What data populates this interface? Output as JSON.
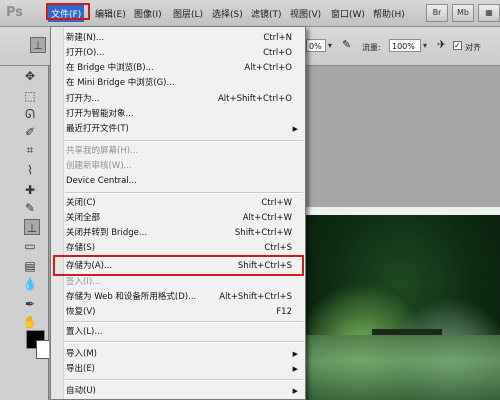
{
  "app": {
    "logo": "Ps"
  },
  "menubar": {
    "items": [
      "文件(F)",
      "编辑(E)",
      "图像(I)",
      "图层(L)",
      "选择(S)",
      "滤镜(T)",
      "视图(V)",
      "窗口(W)",
      "帮助(H)"
    ],
    "buttons": [
      "Br",
      "Mb"
    ]
  },
  "options": {
    "zoom_value": "0%",
    "flow_label": "流量:",
    "flow_value": "100%",
    "align_label": "对齐"
  },
  "file_menu": {
    "items": [
      {
        "label": "新建(N)...",
        "shortcut": "Ctrl+N"
      },
      {
        "label": "打开(O)...",
        "shortcut": "Ctrl+O"
      },
      {
        "label": "在 Bridge 中浏览(B)...",
        "shortcut": "Alt+Ctrl+O"
      },
      {
        "label": "在 Mini Bridge 中浏览(G)...",
        "shortcut": ""
      },
      {
        "label": "打开为...",
        "shortcut": "Alt+Shift+Ctrl+O"
      },
      {
        "label": "打开为智能对象...",
        "shortcut": ""
      },
      {
        "label": "最近打开文件(T)",
        "shortcut": ""
      },
      {
        "label": "共享我的屏幕(H)...",
        "shortcut": ""
      },
      {
        "label": "创建新审核(W)...",
        "shortcut": ""
      },
      {
        "label": "Device Central...",
        "shortcut": ""
      },
      {
        "label": "关闭(C)",
        "shortcut": "Ctrl+W"
      },
      {
        "label": "关闭全部",
        "shortcut": "Alt+Ctrl+W"
      },
      {
        "label": "关闭并转到 Bridge...",
        "shortcut": "Shift+Ctrl+W"
      },
      {
        "label": "存储(S)",
        "shortcut": "Ctrl+S"
      },
      {
        "label": "存储为(A)...",
        "shortcut": "Shift+Ctrl+S"
      },
      {
        "label": "签入(I)...",
        "shortcut": ""
      },
      {
        "label": "存储为 Web 和设备所用格式(D)...",
        "shortcut": "Alt+Shift+Ctrl+S"
      },
      {
        "label": "恢复(V)",
        "shortcut": "F12"
      },
      {
        "label": "置入(L)...",
        "shortcut": ""
      },
      {
        "label": "导入(M)",
        "shortcut": ""
      },
      {
        "label": "导出(E)",
        "shortcut": ""
      },
      {
        "label": "自动(U)",
        "shortcut": ""
      }
    ]
  },
  "tools": [
    "move-tool",
    "marquee-tool",
    "lasso-tool",
    "quick-select-tool",
    "crop-tool",
    "eyedropper-tool",
    "healing-tool",
    "brush-tool",
    "clone-stamp-tool",
    "history-brush-tool",
    "eraser-tool",
    "gradient-tool",
    "blur-tool",
    "dodge-tool",
    "pen-tool",
    "type-tool",
    "path-select-tool",
    "shape-tool",
    "hand-tool",
    "zoom-tool"
  ],
  "colors": {
    "highlight": "#cc1d1d",
    "menu_active": "#2f68c8"
  }
}
